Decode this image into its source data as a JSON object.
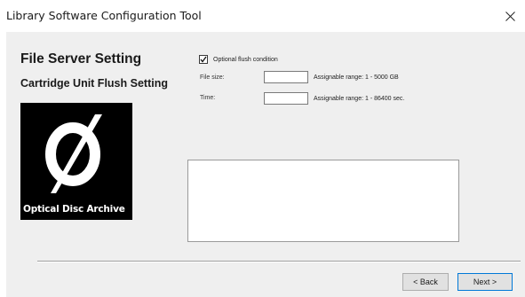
{
  "window": {
    "title": "Library Software Configuration Tool"
  },
  "sidebar": {
    "heading": "File Server Setting",
    "subheading": "Cartridge Unit Flush Setting",
    "logo_text": "Optical Disc Archive"
  },
  "form": {
    "optional_flush": {
      "label": "Optional flush condition",
      "checked": true
    },
    "file_size": {
      "label": "File size:",
      "value": "",
      "range": "Assignable range: 1 - 5000 GB"
    },
    "time": {
      "label": "Time:",
      "value": "",
      "range": "Assignable range: 1 - 86400 sec."
    },
    "message_area": {
      "value": ""
    }
  },
  "footer": {
    "back_label": "< Back",
    "next_label": "Next >"
  },
  "icons": {
    "close": "close-icon",
    "checkmark": "checkmark-icon",
    "logo": "optical-disc-archive-logo"
  }
}
